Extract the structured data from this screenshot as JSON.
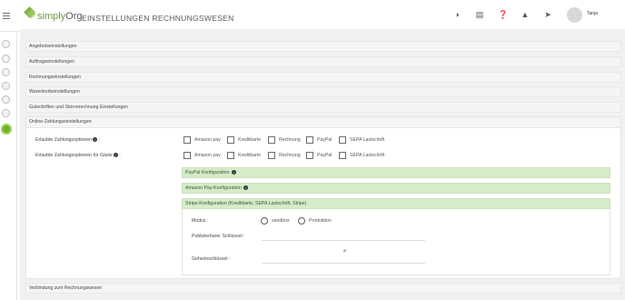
{
  "app": {
    "logo_text_brand": "simply",
    "logo_text_org": "Org",
    "page_title": "EINSTELLUNGEN RECHNUNGSWESEN"
  },
  "topbar": {
    "icons": [
      "lightbulb-icon",
      "book-icon",
      "help-icon",
      "bell-icon",
      "rocket-icon"
    ],
    "username": "Tanja"
  },
  "sections": {
    "angebot": "Angebotseinstellungen",
    "auftrag": "Auftragseinstellungen",
    "rechnung": "Rechnungseinstellungen",
    "warenkorb": "Warenkorbeinstellungen",
    "gutschriften": "Gutschriften und Stornorechnung Einstellungen",
    "online": "Online-Zahlungseinstellungen",
    "verbindung": "Verbindung zum Rechnungswesen"
  },
  "online": {
    "erlaubt_label": "Erlaubte Zahlungsoptionen",
    "erlaubt_gaeste_label": "Erlaubte Zahlungsoptionen für Gäste",
    "options": [
      "Amazon pay",
      "Kreditkarte",
      "Rechnung",
      "PayPal",
      "SEPA Lastschrift"
    ],
    "paypal_config": "PayPal Konfiguration",
    "amazon_config": "Amazon Pay-Konfiguration",
    "stripe_config": "Stripe-Konfiguration (Kreditkarte, SEPA Lastschrift, Stripe)",
    "modus_label": "Modus :",
    "modus_options": [
      "sandbox",
      "Produktion"
    ],
    "public_key_label": "Publizierbarer Schlüssel :",
    "secret_key_label": "Geheimschlüssel :"
  },
  "colors": {
    "accent_green": "#6fb12b",
    "config_bar": "#d6ecc8"
  }
}
